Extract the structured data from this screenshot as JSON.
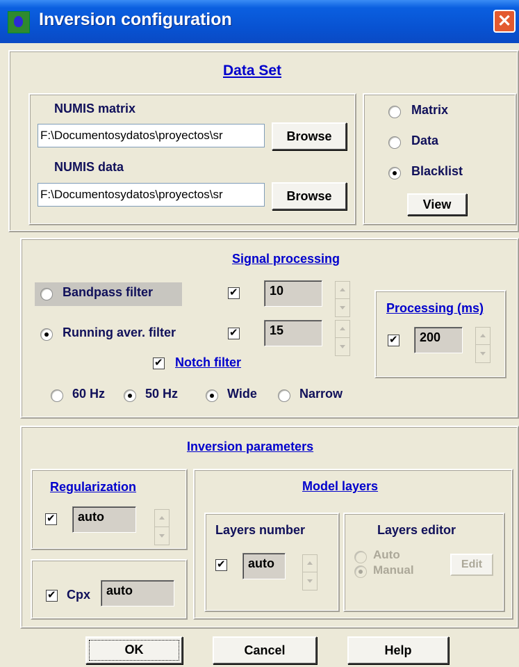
{
  "window": {
    "title": "Inversion configuration",
    "close_symbol": "✕"
  },
  "dataset": {
    "header": "Data Set",
    "matrix_label": "NUMIS matrix",
    "matrix_path": "F:\\Documentosydatos\\proyectos\\sr",
    "matrix_browse": "Browse",
    "data_label": "NUMIS data",
    "data_path": "F:\\Documentosydatos\\proyectos\\sr",
    "data_browse": "Browse",
    "radio_matrix": "Matrix",
    "radio_data": "Data",
    "radio_blacklist": "Blacklist",
    "selected": "Blacklist",
    "view_button": "View"
  },
  "signal": {
    "header": "Signal processing",
    "bandpass_label": "Bandpass filter",
    "bandpass_value": "10",
    "running_label": "Running aver. filter",
    "running_value": "15",
    "notch_label": "Notch filter",
    "hz60": "60 Hz",
    "hz50": "50 Hz",
    "wide": "Wide",
    "narrow": "Narrow",
    "processing_header": "Processing (ms)",
    "processing_value": "200"
  },
  "inversion": {
    "header": "Inversion parameters",
    "regularization_header": "Regularization",
    "regularization_value": "auto",
    "cpx_label": "Cpx",
    "cpx_value": "auto",
    "model_layers_header": "Model layers",
    "layers_number_label": "Layers number",
    "layers_number_value": "auto",
    "layers_editor_label": "Layers editor",
    "auto_label": "Auto",
    "manual_label": "Manual",
    "edit_button": "Edit"
  },
  "buttons": {
    "ok": "OK",
    "cancel": "Cancel",
    "help": "Help"
  },
  "colors": {
    "titlebar": "#0a5fe0",
    "face": "#ece9d8",
    "header_link": "#0000cc",
    "label_text": "#10105a"
  }
}
